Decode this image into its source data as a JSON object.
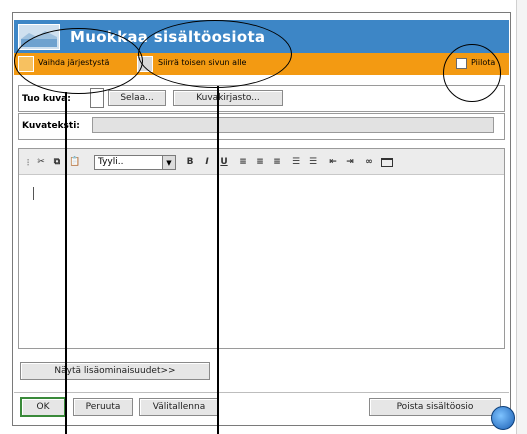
{
  "window": {
    "title": "Muokkaa sisältöosiota"
  },
  "actionbar": {
    "reorder_label": "Vaihda järjestystä",
    "move_label": "Siirrä toisen sivun alle",
    "hide_label": "Piilota"
  },
  "image_row": {
    "label": "Tuo kuva:",
    "browse_label": "Selaa...",
    "library_label": "Kuvakirjasto..."
  },
  "caption_row": {
    "label": "Kuvateksti:",
    "value": ""
  },
  "editor": {
    "style_value": "Tyyli..",
    "content": ""
  },
  "more_options_label": "Näytä lisäominaisuudet>>",
  "footer": {
    "ok_label": "OK",
    "cancel_label": "Peruuta",
    "restore_label": "Välitallenna",
    "delete_label": "Poista sisältöosio"
  },
  "colors": {
    "titlebar": "#3d86c6",
    "actionbar": "#f39a12"
  }
}
